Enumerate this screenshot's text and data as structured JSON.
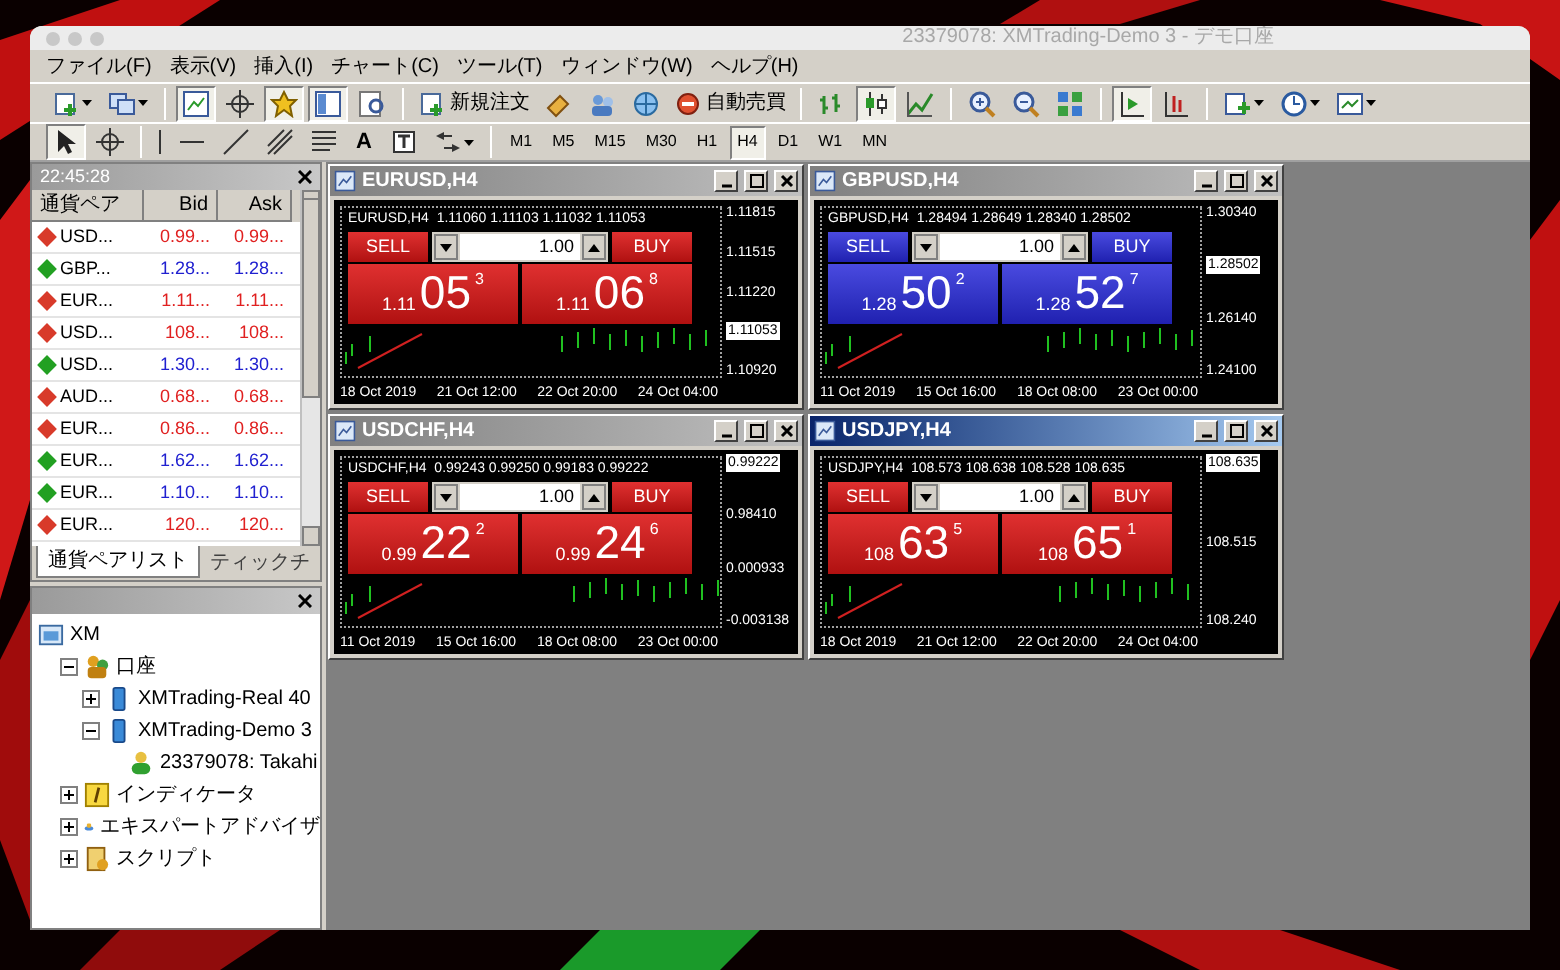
{
  "window": {
    "title": "23379078: XMTrading-Demo 3 - デモ口座"
  },
  "menu": [
    "ファイル(F)",
    "表示(V)",
    "挿入(I)",
    "チャート(C)",
    "ツール(T)",
    "ウィンドウ(W)",
    "ヘルプ(H)"
  ],
  "toolbar": [
    {
      "kind": "icon",
      "pressed": false,
      "dropdown": true
    },
    {
      "kind": "icon",
      "pressed": false,
      "dropdown": true
    },
    {
      "kind": "separator"
    },
    {
      "kind": "icon",
      "pressed": true,
      "dropdown": false
    },
    {
      "kind": "icon",
      "pressed": false,
      "dropdown": false
    },
    {
      "kind": "icon",
      "pressed": true,
      "dropdown": false
    },
    {
      "kind": "icon",
      "pressed": true,
      "dropdown": false
    },
    {
      "kind": "icon",
      "pressed": false,
      "dropdown": false
    },
    {
      "kind": "separator"
    },
    {
      "kind": "labeled",
      "label": "新規注文"
    },
    {
      "kind": "icon",
      "pressed": false,
      "dropdown": false
    },
    {
      "kind": "icon",
      "pressed": false,
      "dropdown": false
    },
    {
      "kind": "icon",
      "pressed": false,
      "dropdown": false
    },
    {
      "kind": "labeled",
      "label": "自動売買"
    },
    {
      "kind": "separator"
    },
    {
      "kind": "icon",
      "pressed": false,
      "dropdown": false
    },
    {
      "kind": "icon",
      "pressed": true,
      "dropdown": false
    },
    {
      "kind": "icon",
      "pressed": false,
      "dropdown": false
    },
    {
      "kind": "separator"
    },
    {
      "kind": "icon",
      "pressed": false,
      "dropdown": false
    },
    {
      "kind": "icon",
      "pressed": false,
      "dropdown": false
    },
    {
      "kind": "icon",
      "pressed": false,
      "dropdown": false
    },
    {
      "kind": "separator"
    },
    {
      "kind": "icon",
      "pressed": true,
      "dropdown": false
    },
    {
      "kind": "icon",
      "pressed": false,
      "dropdown": false
    },
    {
      "kind": "separator"
    },
    {
      "kind": "icon",
      "pressed": false,
      "dropdown": true
    },
    {
      "kind": "icon",
      "pressed": false,
      "dropdown": true
    },
    {
      "kind": "icon",
      "pressed": false,
      "dropdown": true
    }
  ],
  "drawing_toolbar": [
    {
      "kind": "icon",
      "pressed": true,
      "dropdown": false
    },
    {
      "kind": "icon",
      "pressed": false,
      "dropdown": false
    },
    {
      "kind": "separator"
    },
    {
      "kind": "icon",
      "pressed": false,
      "dropdown": false
    },
    {
      "kind": "icon",
      "pressed": false,
      "dropdown": false
    },
    {
      "kind": "icon",
      "pressed": false,
      "dropdown": false
    },
    {
      "kind": "icon",
      "pressed": false,
      "dropdown": false
    },
    {
      "kind": "icon",
      "pressed": false,
      "dropdown": false
    },
    {
      "kind": "text_tool",
      "label": "A"
    },
    {
      "kind": "icon",
      "pressed": false,
      "dropdown": false
    },
    {
      "kind": "icon",
      "pressed": false,
      "dropdown": true
    },
    {
      "kind": "separator"
    }
  ],
  "timeframes": [
    {
      "label": "M1",
      "selected": false
    },
    {
      "label": "M5",
      "selected": false
    },
    {
      "label": "M15",
      "selected": false
    },
    {
      "label": "M30",
      "selected": false
    },
    {
      "label": "H1",
      "selected": false
    },
    {
      "label": "H4",
      "selected": true
    },
    {
      "label": "D1",
      "selected": false
    },
    {
      "label": "W1",
      "selected": false
    },
    {
      "label": "MN",
      "selected": false
    }
  ],
  "market_watch": {
    "time": "22:45:28",
    "columns": [
      "通貨ペア",
      "Bid",
      "Ask"
    ],
    "rows": [
      {
        "symbol": "USD...",
        "bid": "0.99...",
        "ask": "0.99...",
        "rising": false
      },
      {
        "symbol": "GBP...",
        "bid": "1.28...",
        "ask": "1.28...",
        "rising": true
      },
      {
        "symbol": "EUR...",
        "bid": "1.11...",
        "ask": "1.11...",
        "rising": false
      },
      {
        "symbol": "USD...",
        "bid": "108...",
        "ask": "108...",
        "rising": false
      },
      {
        "symbol": "USD...",
        "bid": "1.30...",
        "ask": "1.30...",
        "rising": true
      },
      {
        "symbol": "AUD...",
        "bid": "0.68...",
        "ask": "0.68...",
        "rising": false
      },
      {
        "symbol": "EUR...",
        "bid": "0.86...",
        "ask": "0.86...",
        "rising": false
      },
      {
        "symbol": "EUR...",
        "bid": "1.62...",
        "ask": "1.62...",
        "rising": true
      },
      {
        "symbol": "EUR...",
        "bid": "1.10...",
        "ask": "1.10...",
        "rising": true
      },
      {
        "symbol": "EUR...",
        "bid": "120...",
        "ask": "120...",
        "rising": false
      }
    ],
    "tabs": [
      {
        "label": "通貨ペアリスト",
        "selected": true
      },
      {
        "label": "ティックチ",
        "selected": false
      }
    ]
  },
  "navigator": {
    "tree": [
      {
        "kind": "root",
        "label": "XM",
        "children": [
          {
            "kind": "accounts",
            "label": "口座",
            "expanded": true,
            "children": [
              {
                "kind": "server",
                "label": "XMTrading-Real 40",
                "expanded": false
              },
              {
                "kind": "server",
                "label": "XMTrading-Demo 3",
                "expanded": true,
                "children": [
                  {
                    "kind": "account",
                    "label": "23379078: Takahi"
                  }
                ]
              }
            ]
          },
          {
            "kind": "indicators",
            "label": "インディケータ",
            "expanded": false
          },
          {
            "kind": "experts",
            "label": "エキスパートアドバイザ",
            "expanded": false
          },
          {
            "kind": "scripts",
            "label": "スクリプト",
            "expanded": false
          }
        ]
      }
    ]
  },
  "charts": [
    {
      "title": "EURUSD,H4",
      "active": false,
      "rising": false,
      "ohlc": "EURUSD,H4  1.11060 1.11103 1.11032 1.11053",
      "lot": "1.00",
      "sell": {
        "label": "SELL",
        "prefix": "1.11",
        "big": "05",
        "pip": "3"
      },
      "buy": {
        "label": "BUY",
        "prefix": "1.11",
        "big": "06",
        "pip": "8"
      },
      "price_axis": [
        {
          "text": "1.11815",
          "current": false
        },
        {
          "text": "1.11515",
          "current": false
        },
        {
          "text": "1.11220",
          "current": false
        },
        {
          "text": "1.11053",
          "current": true
        },
        {
          "text": "1.10920",
          "current": false
        }
      ],
      "time_axis": [
        "18 Oct 2019",
        "21 Oct 12:00",
        "22 Oct 20:00",
        "24 Oct 04:00"
      ]
    },
    {
      "title": "GBPUSD,H4",
      "active": false,
      "rising": true,
      "ohlc": "GBPUSD,H4  1.28494 1.28649 1.28340 1.28502",
      "lot": "1.00",
      "sell": {
        "label": "SELL",
        "prefix": "1.28",
        "big": "50",
        "pip": "2"
      },
      "buy": {
        "label": "BUY",
        "prefix": "1.28",
        "big": "52",
        "pip": "7"
      },
      "price_axis": [
        {
          "text": "1.30340",
          "current": false
        },
        {
          "text": "1.28502",
          "current": true
        },
        {
          "text": "1.26140",
          "current": false
        },
        {
          "text": "1.24100",
          "current": false
        }
      ],
      "time_axis": [
        "11 Oct 2019",
        "15 Oct 16:00",
        "18 Oct 08:00",
        "23 Oct 00:00"
      ]
    },
    {
      "title": "USDCHF,H4",
      "active": false,
      "rising": false,
      "ohlc": "USDCHF,H4  0.99243 0.99250 0.99183 0.99222",
      "lot": "1.00",
      "sell": {
        "label": "SELL",
        "prefix": "0.99",
        "big": "22",
        "pip": "2"
      },
      "buy": {
        "label": "BUY",
        "prefix": "0.99",
        "big": "24",
        "pip": "6"
      },
      "price_axis": [
        {
          "text": "0.99222",
          "current": true
        },
        {
          "text": "0.98410",
          "current": false
        },
        {
          "text": "0.000933",
          "current": false
        },
        {
          "text": "-0.003138",
          "current": false
        }
      ],
      "time_axis": [
        "11 Oct 2019",
        "15 Oct 16:00",
        "18 Oct 08:00",
        "23 Oct 00:00"
      ]
    },
    {
      "title": "USDJPY,H4",
      "active": true,
      "rising": false,
      "ohlc": "USDJPY,H4  108.573 108.638 108.528 108.635",
      "lot": "1.00",
      "sell": {
        "label": "SELL",
        "prefix": "108",
        "big": "63",
        "pip": "5"
      },
      "buy": {
        "label": "BUY",
        "prefix": "108",
        "big": "65",
        "pip": "1"
      },
      "price_axis": [
        {
          "text": "108.635",
          "current": true
        },
        {
          "text": "108.515",
          "current": false
        },
        {
          "text": "108.240",
          "current": false
        }
      ],
      "time_axis": [
        "18 Oct 2019",
        "21 Oct 12:00",
        "22 Oct 20:00",
        "24 Oct 04:00"
      ]
    }
  ]
}
